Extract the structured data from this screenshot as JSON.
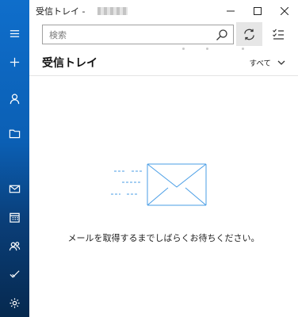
{
  "window": {
    "title": "受信トレイ -",
    "controls": [
      "minimize",
      "maximize",
      "close"
    ]
  },
  "nav_rail": {
    "items": [
      {
        "icon": "hamburger-icon"
      },
      {
        "icon": "plus-icon"
      },
      {
        "icon": "person-icon"
      },
      {
        "icon": "folder-icon"
      },
      {
        "icon": "mail-icon"
      },
      {
        "icon": "calendar-icon"
      },
      {
        "icon": "people-icon"
      },
      {
        "icon": "todo-icon"
      },
      {
        "icon": "settings-icon"
      }
    ],
    "colors": {
      "top": "#0f6ecb",
      "bottom": "#06294f"
    }
  },
  "search": {
    "placeholder": "検索",
    "value": ""
  },
  "toolbar": {
    "sync_icon": "sync-icon",
    "selection_icon": "select-mode-icon"
  },
  "folder": {
    "title": "受信トレイ",
    "filter_label": "すべて"
  },
  "empty_state": {
    "message": "メールを取得するまでしばらくお待ちください。",
    "icon": "envelope-icon",
    "accent": "#2b88d8"
  }
}
